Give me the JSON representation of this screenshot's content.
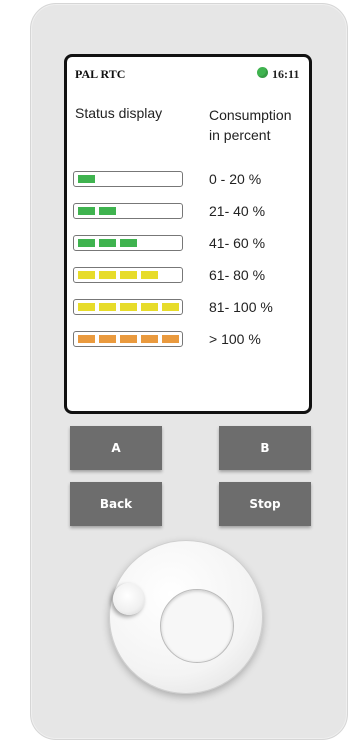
{
  "header": {
    "device_title": "PAL RTC",
    "clock": "16:11",
    "battery_color": "#3fb34f"
  },
  "table": {
    "col_left": "Status display",
    "col_right": "Consumption\nin percent",
    "rows": [
      {
        "range": "0 - 20 %",
        "segments": 1,
        "color": "#3fb34f"
      },
      {
        "range": "21- 40 %",
        "segments": 2,
        "color": "#3fb34f"
      },
      {
        "range": "41- 60 %",
        "segments": 3,
        "color": "#3fb34f"
      },
      {
        "range": "61- 80 %",
        "segments": 4,
        "color": "#e7dc2a"
      },
      {
        "range": "81- 100 %",
        "segments": 5,
        "color": "#e7dc2a"
      },
      {
        "range": "> 100 %",
        "segments": 5,
        "color": "#ea9a3e"
      }
    ]
  },
  "buttons": {
    "a": "A",
    "b": "B",
    "back": "Back",
    "stop": "Stop"
  },
  "dial": {
    "icon": "rotary-dial"
  }
}
